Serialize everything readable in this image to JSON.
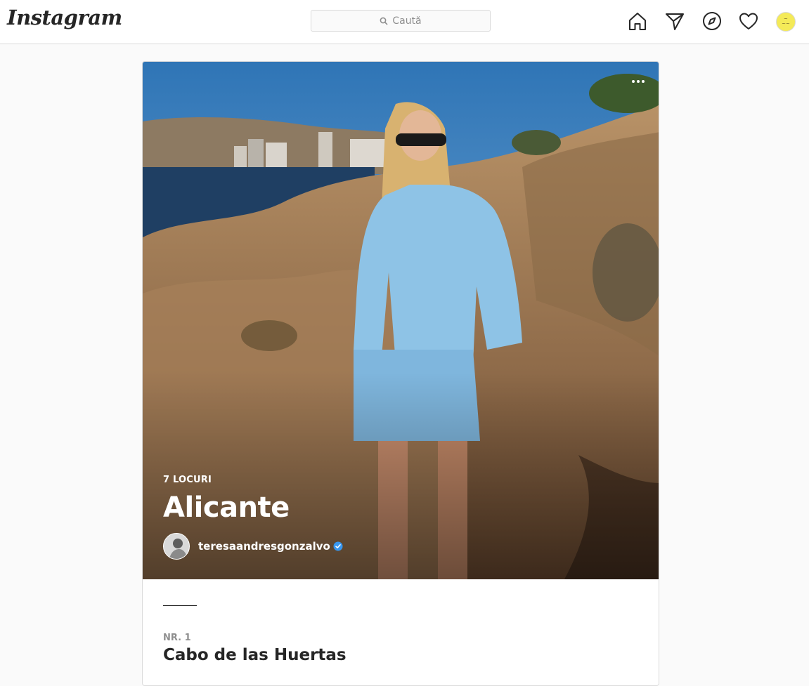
{
  "header": {
    "logo": "Instagram",
    "search_placeholder": "Caută",
    "icons": [
      "home-icon",
      "direct-icon",
      "explore-icon",
      "activity-heart-icon",
      "profile-avatar"
    ]
  },
  "guide": {
    "count": "7 LOCURI",
    "title": "Alicante",
    "author": "teresaandresgonzalvo",
    "author_verified": true
  },
  "place": {
    "number": "NR. 1",
    "name": "Cabo de las Huertas"
  },
  "colors": {
    "verified_blue": "#3897f0",
    "text_primary": "#262626",
    "text_secondary": "#8e8e8e"
  }
}
